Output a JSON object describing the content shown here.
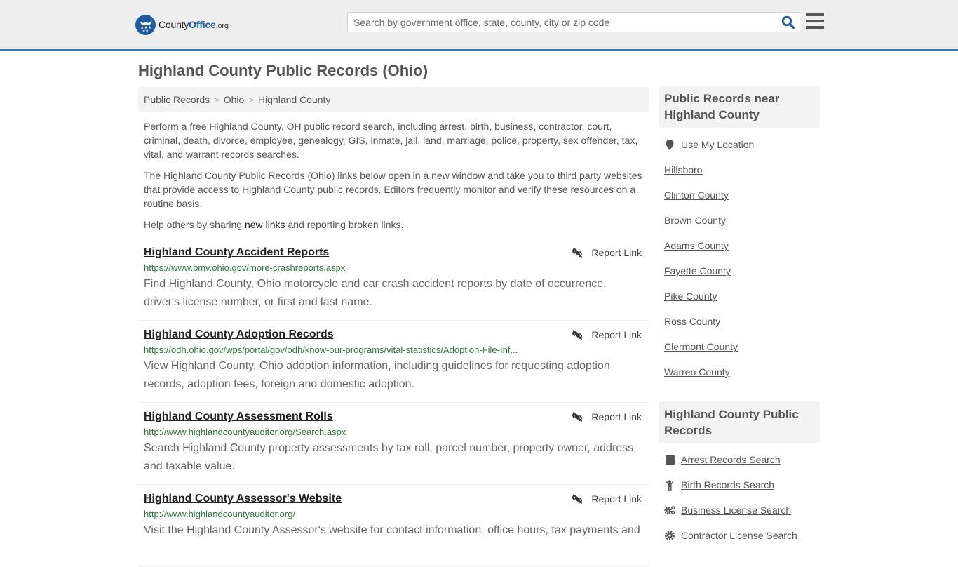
{
  "header": {
    "logo": {
      "name_part1": "County",
      "name_part2": "Office",
      "tld": ".org"
    },
    "search": {
      "placeholder": "Search by government office, state, county, city or zip code",
      "value": ""
    },
    "colors": {
      "brand": "#1f5c9e",
      "accent_border": "#3a7bad"
    }
  },
  "page": {
    "title": "Highland County Public Records (Ohio)",
    "breadcrumb": [
      "Public Records",
      "Ohio",
      "Highland County"
    ],
    "intro": {
      "p1": "Perform a free Highland County, OH public record search, including arrest, birth, business, contractor, court, criminal, death, divorce, employee, genealogy, GIS, inmate, jail, land, marriage, police, property, sex offender, tax, vital, and warrant records searches.",
      "p2": "The Highland County Public Records (Ohio) links below open in a new window and take you to third party websites that provide access to Highland County public records. Editors frequently monitor and verify these resources on a routine basis.",
      "p3_before": "Help others by sharing ",
      "p3_link": "new links",
      "p3_after": " and reporting broken links."
    }
  },
  "records": [
    {
      "title": "Highland County Accident Reports",
      "url": "https://www.bmv.ohio.gov/more-crashreports.aspx",
      "description": "Find Highland County, Ohio motorcycle and car crash accident reports by date of occurrence, driver's license number, or first and last name.",
      "report_label": "Report Link"
    },
    {
      "title": "Highland County Adoption Records",
      "url": "https://odh.ohio.gov/wps/portal/gov/odh/know-our-programs/vital-statistics/Adoption-File-Inf...",
      "description": "View Highland County, Ohio adoption information, including guidelines for requesting adoption records, adoption fees, foreign and domestic adoption.",
      "report_label": "Report Link"
    },
    {
      "title": "Highland County Assessment Rolls",
      "url": "http://www.highlandcountyauditor.org/Search.aspx",
      "description": "Search Highland County property assessments by tax roll, parcel number, property owner, address, and taxable value.",
      "report_label": "Report Link"
    },
    {
      "title": "Highland County Assessor's Website",
      "url": "http://www.highlandcountyauditor.org/",
      "description": "Visit the Highland County Assessor's website for contact information, office hours, tax payments and",
      "report_label": "Report Link"
    }
  ],
  "sidebar": {
    "nearby": {
      "heading": "Public Records near Highland County",
      "use_location": "Use My Location",
      "items": [
        "Hillsboro",
        "Clinton County",
        "Brown County",
        "Adams County",
        "Fayette County",
        "Pike County",
        "Ross County",
        "Clermont County",
        "Warren County"
      ]
    },
    "records": {
      "heading": "Highland County Public Records",
      "items": [
        {
          "label": "Arrest Records Search",
          "icon": "square-icon"
        },
        {
          "label": "Birth Records Search",
          "icon": "child-icon"
        },
        {
          "label": "Business License Search",
          "icon": "cogs-icon"
        },
        {
          "label": "Contractor License Search",
          "icon": "gear-icon"
        }
      ]
    }
  }
}
